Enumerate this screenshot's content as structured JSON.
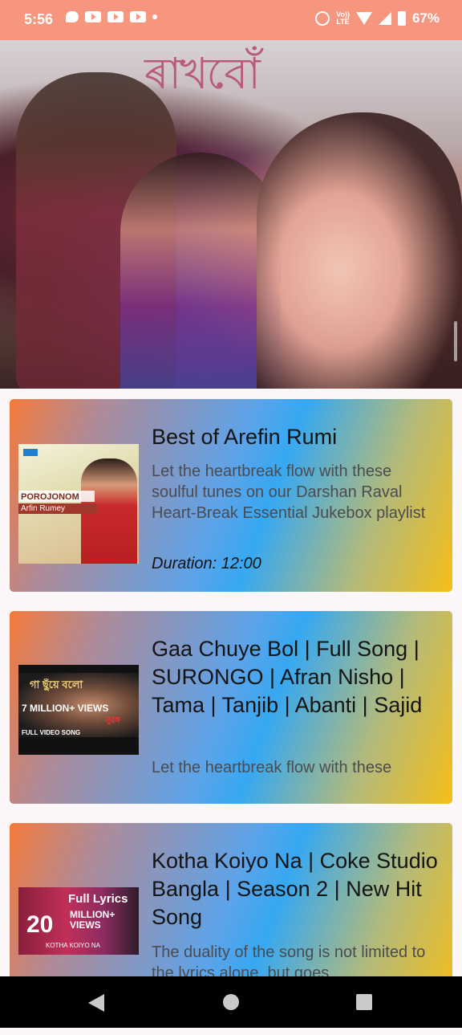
{
  "status_bar": {
    "time": "5:56",
    "volte_line1": "Vo))",
    "volte_line2": "LTE",
    "battery": "67%"
  },
  "hero": {
    "title_art": "ৰাখবোঁ"
  },
  "songs": [
    {
      "title": "Best of Arefin Rumi",
      "description": "Let the heartbreak flow with these soulful tunes on our Darshan Raval Heart-Break Essential Jukebox playlist",
      "duration": "Duration: 12:00",
      "thumb_text_1": "POROJONOM",
      "thumb_text_2": "Arfin Rumey"
    },
    {
      "title": "Gaa Chuye Bol | Full Song | SURONGO | Afran Nisho | Tama | Tanjib | Abanti | Sajid",
      "description": "Let the heartbreak flow with these",
      "thumb_text_1": "গা ছুঁয়ে বলো",
      "thumb_text_2": "7 MILLION+ VIEWS",
      "thumb_text_3": "FULL VIDEO SONG",
      "thumb_text_4": "সুরঙ্গ"
    },
    {
      "title": "Kotha Koiyo Na | Coke Studio Bangla | Season 2 | New Hit Song",
      "description": "The duality of the song is not limited to the lyrics alone, but goes",
      "thumb_text_1": "Full Lyrics",
      "thumb_text_2": "20",
      "thumb_text_3": "MILLION+ VIEWS",
      "thumb_text_4": "KOTHA KOIYO NA"
    }
  ],
  "colors": {
    "status_bar": "#f7967f",
    "card_gradient_start": "#f47a3a",
    "card_gradient_mid": "#36a8f2",
    "card_gradient_end": "#f5be18"
  }
}
